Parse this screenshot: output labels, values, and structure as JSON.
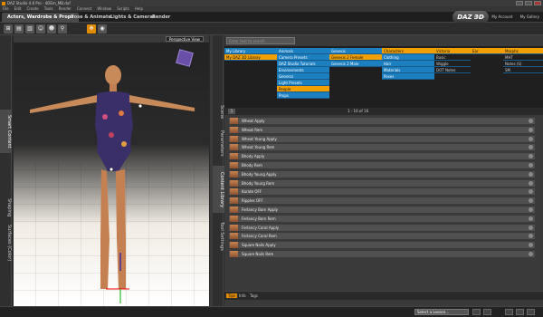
{
  "window": {
    "title": "DAZ Studio 4.6 Pro - 4DEm_MB.duf"
  },
  "menu": [
    "File",
    "Edit",
    "Create",
    "Tools",
    "Render",
    "Connect",
    "Window",
    "Scripts",
    "Help"
  ],
  "main_tabs": [
    "Actors, Wardrobe & Props",
    "Pose & Animate",
    "Lights & Cameras",
    "Render"
  ],
  "logo_text": "DAZ 3D",
  "top_links": [
    "Home",
    "My Account",
    "My Gallery"
  ],
  "left_tabs": [
    "Smart Content",
    "Shaping",
    "Surfaces (Color)"
  ],
  "viewport": {
    "camera": "Perspective View"
  },
  "right_tabs": [
    "Scene",
    "Parameters",
    "Content Library",
    "Tool Settings"
  ],
  "filter_placeholder": "Enter text to search",
  "browser_columns": [
    {
      "items": [
        {
          "label": "My Library",
          "sel": false
        },
        {
          "label": "My DAZ 3D Library",
          "sel": true
        }
      ]
    },
    {
      "items": [
        {
          "label": "Animals",
          "sel": false
        },
        {
          "label": "Camera Presets",
          "sel": false
        },
        {
          "label": "DAZ Studio Tutorials",
          "sel": false
        },
        {
          "label": "Environments",
          "sel": false
        },
        {
          "label": "General",
          "sel": false
        },
        {
          "label": "Light Presets",
          "sel": false
        },
        {
          "label": "People",
          "sel": true
        },
        {
          "label": "Props",
          "sel": false
        }
      ]
    },
    {
      "items": [
        {
          "label": "Genesis",
          "sel": false
        },
        {
          "label": "Genesis 2 Female",
          "sel": true
        },
        {
          "label": "Genesis 2 Male",
          "sel": false
        }
      ]
    },
    {
      "items": [
        {
          "label": "Characters",
          "sel": true
        },
        {
          "label": "Clothing",
          "sel": false
        },
        {
          "label": "Hair",
          "sel": false
        },
        {
          "label": "Materials",
          "sel": false
        },
        {
          "label": "Poses",
          "sel": false
        }
      ]
    },
    {
      "items": [
        {
          "label": "Victoria",
          "sel": true
        },
        {
          "label": "Basic",
          "sel": false
        },
        {
          "label": "Wiggle",
          "sel": false
        },
        {
          "label": "DOT Notes",
          "sel": false
        }
      ]
    },
    {
      "items": [
        {
          "label": "Ear",
          "sel": true
        }
      ]
    },
    {
      "items": [
        {
          "label": "Morphs",
          "sel": true
        },
        {
          "label": "MHT",
          "sel": false
        },
        {
          "label": "Notes (S)",
          "sel": false
        },
        {
          "label": "SM",
          "sel": false
        }
      ]
    }
  ],
  "page": {
    "number": "1",
    "info": "1 - 16 of 16"
  },
  "assets": [
    "Wheat Apply",
    "Wheat Rem",
    "Wheat Young Apply",
    "Wheat Young Rem",
    "Bhody Apply",
    "Bhody Rem",
    "Bhody Young Apply",
    "Bhody Young Rem",
    "Karate OFF",
    "Ripples OFF",
    "Ferlancy Barn Apply",
    "Ferlancy Barn Rem",
    "Ferlancy Coral Apply",
    "Ferlancy Coral Rem",
    "Square Nails Apply",
    "Square Nails Rem"
  ],
  "bottom_tabs": [
    "Tips",
    "Info",
    "Tags"
  ],
  "status": {
    "lesson": "Select a Lesson..."
  }
}
